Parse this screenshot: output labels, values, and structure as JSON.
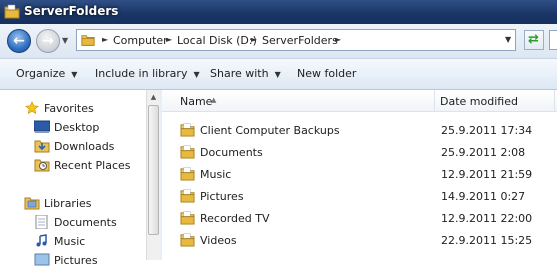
{
  "window": {
    "title": "ServerFolders"
  },
  "address": {
    "breadcrumbs": [
      "Computer",
      "Local Disk (D:)",
      "ServerFolders"
    ]
  },
  "toolbar": {
    "organize": "Organize",
    "include_in_library": "Include in library",
    "share_with": "Share with",
    "new_folder": "New folder"
  },
  "nav": {
    "favorites": {
      "label": "Favorites",
      "items": [
        "Desktop",
        "Downloads",
        "Recent Places"
      ]
    },
    "libraries": {
      "label": "Libraries",
      "items": [
        "Documents",
        "Music",
        "Pictures"
      ]
    }
  },
  "filelist": {
    "columns": {
      "name": "Name",
      "date_modified": "Date modified"
    },
    "rows": [
      {
        "name": "Client Computer Backups",
        "date": "25.9.2011 17:34"
      },
      {
        "name": "Documents",
        "date": "25.9.2011 2:08"
      },
      {
        "name": "Music",
        "date": "12.9.2011 21:59"
      },
      {
        "name": "Pictures",
        "date": "14.9.2011 0:27"
      },
      {
        "name": "Recorded TV",
        "date": "12.9.2011 22:00"
      },
      {
        "name": "Videos",
        "date": "22.9.2011 15:25"
      }
    ]
  },
  "colors": {
    "titlebar": "#1a3565",
    "folder": "#e8c25a",
    "refresh": "#2a9d2a"
  }
}
